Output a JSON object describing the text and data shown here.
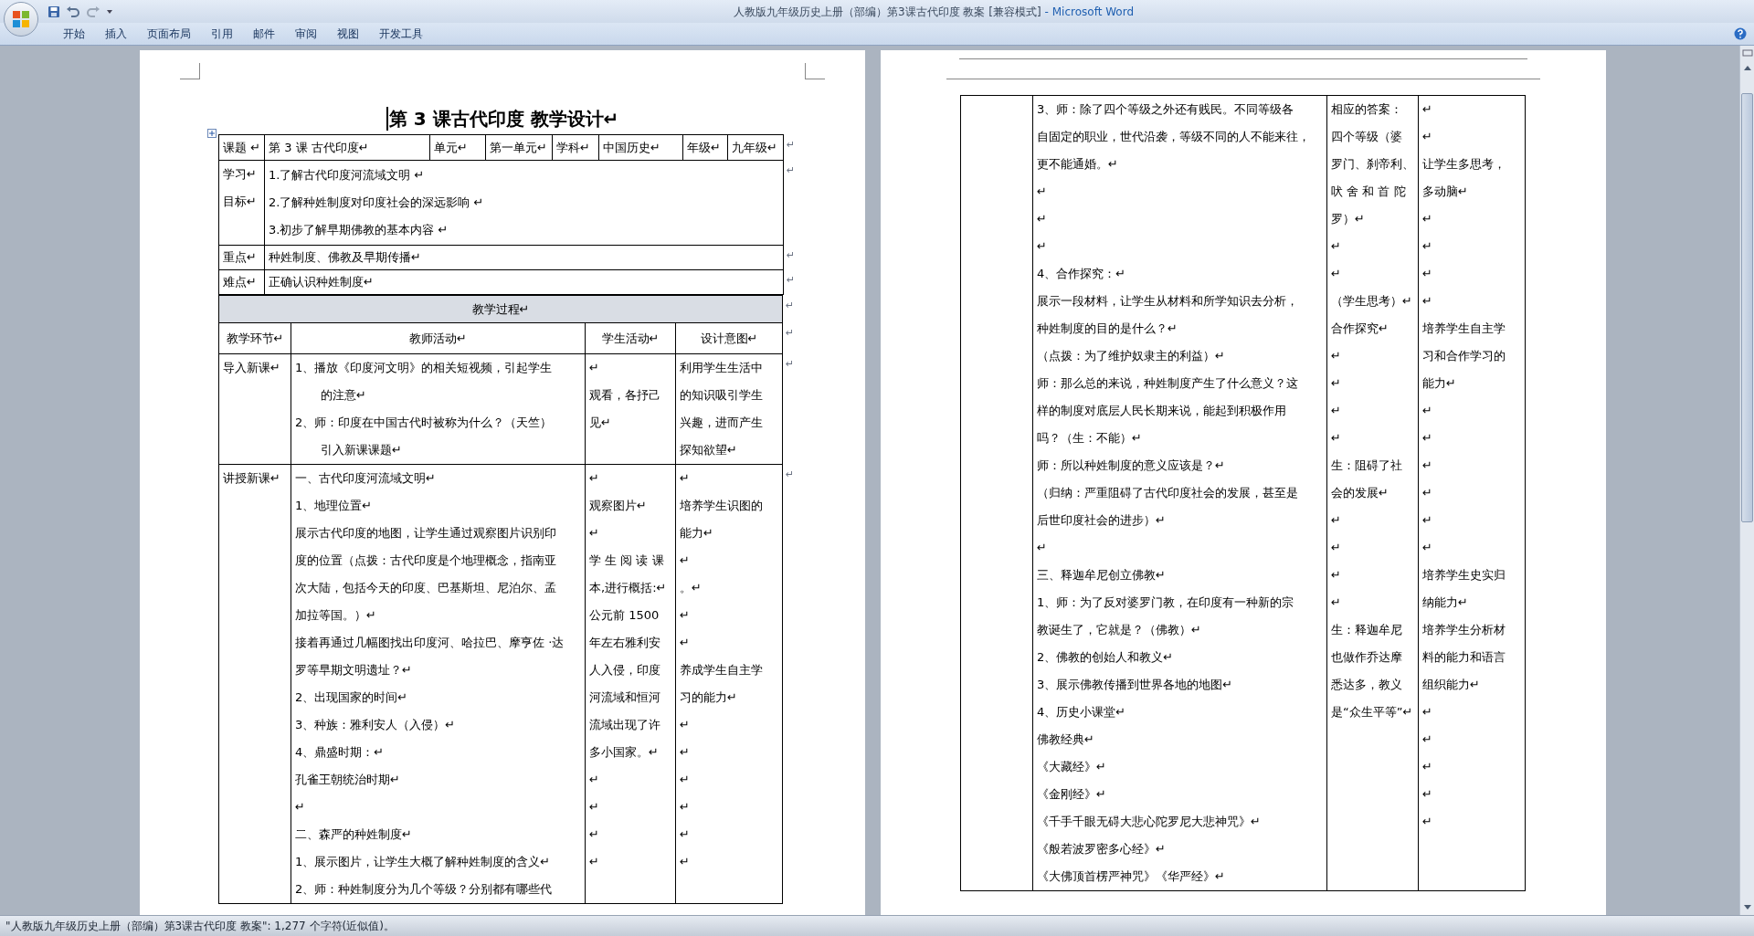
{
  "window": {
    "title": "人教版九年级历史上册（部编）第3课古代印度 教案 [兼容模式]",
    "app_suffix": "- Microsoft Word"
  },
  "ribbon_tabs": [
    "开始",
    "插入",
    "页面布局",
    "引用",
    "邮件",
    "审阅",
    "视图",
    "开发工具"
  ],
  "left_page": {
    "heading": "第 3 课古代印度  教学设计↵",
    "info_table": {
      "header_cells": [
        "课题 ↵",
        "第 3 课 古代印度↵",
        "单元↵",
        "第一单元↵",
        "学科↵",
        "中国历史↵",
        "年级↵",
        "九年级↵"
      ],
      "header_end": "↵",
      "objectives": {
        "label": [
          "学习↵",
          "目标↵"
        ],
        "items": [
          "1.了解古代印度河流域文明 ↵",
          "2.了解种姓制度对印度社会的深远影响 ↵",
          "3.初步了解早期佛教的基本内容 ↵"
        ],
        "end": "↵"
      },
      "rows": [
        {
          "label": "重点↵",
          "value": "种姓制度、佛教及早期传播↵",
          "end": "↵"
        },
        {
          "label": "难点↵",
          "value": "正确认识种姓制度↵",
          "end": "↵"
        }
      ]
    },
    "process_table": {
      "caption": "教学过程↵",
      "caption_end": "↵",
      "columns": [
        "教学环节↵",
        "教师活动↵",
        "学生活动↵",
        "设计意图↵"
      ],
      "columns_end": "↵",
      "rows": [
        {
          "stage": [
            "导入新课↵"
          ],
          "teacher": [
            {
              "kind": "item",
              "text": "1、播放《印度河文明》的相关短视频，引起学生"
            },
            {
              "kind": "cont",
              "text": "的注意↵"
            },
            {
              "kind": "item",
              "text": "2、师：印度在中国古代时被称为什么？（天竺）"
            },
            {
              "kind": "cont",
              "text": "引入新课课题↵"
            }
          ],
          "student": [
            "↵",
            "观看，各抒己",
            "见↵"
          ],
          "design": [
            "利用学生生活中",
            "的知识吸引学生",
            "兴趣，进而产生",
            "探知欲望↵"
          ],
          "end": "↵"
        },
        {
          "stage": [
            "讲授新课↵"
          ],
          "teacher": [
            "一、古代印度河流域文明↵",
            "1、地理位置↵",
            "展示古代印度的地图，让学生通过观察图片识别印",
            "度的位置（点拨：古代印度是个地理概念，指南亚",
            "次大陆，包括今天的印度、巴基斯坦、尼泊尔、孟",
            "加拉等国。）↵",
            "接着再通过几幅图找出印度河、哈拉巴、摩亨佐 ·达",
            "罗等早期文明遗址？↵",
            "2、出现国家的时间↵",
            "3、种族：雅利安人（入侵）↵",
            "4、鼎盛时期：↵",
            "孔雀王朝统治时期↵",
            "↵",
            "二、森严的种姓制度↵",
            "1、展示图片，让学生大概了解种姓制度的含义↵",
            "2、师：种姓制度分为几个等级？分别都有哪些代"
          ],
          "student": [
            "↵",
            "观察图片↵",
            "↵",
            "学 生 阅 读 课",
            "本,进行概括:↵",
            "公元前  1500",
            "年左右雅利安",
            "人入侵，印度",
            "河流域和恒河",
            "流域出现了许",
            "多小国家。↵",
            "↵",
            "↵",
            "↵",
            "↵"
          ],
          "design": [
            "↵",
            "培养学生识图的",
            "能力↵",
            "↵",
            "。↵",
            "↵",
            "↵",
            "养成学生自主学",
            "习的能力↵",
            "↵",
            "↵",
            "↵",
            "↵",
            "↵",
            "↵"
          ],
          "end": "↵"
        }
      ]
    }
  },
  "right_page": {
    "process_table": {
      "rows": [
        {
          "stage": [],
          "teacher": [
            "3、师：除了四个等级之外还有贱民。不同等级各",
            "自固定的职业，世代沿袭，等级不同的人不能来往，",
            "更不能通婚。↵",
            "↵",
            "↵",
            "↵",
            "4、合作探究：↵",
            "展示一段材料，让学生从材料和所学知识去分析，",
            "种姓制度的目的是什么？↵",
            "（点拨：为了维护奴隶主的利益）↵",
            "师：那么总的来说，种姓制度产生了什么意义？这",
            "样的制度对底层人民长期来说，能起到积极作用",
            "吗？（生：不能）↵",
            "师：所以种姓制度的意义应该是？↵",
            "（归纳：严重阻碍了古代印度社会的发展，甚至是",
            "后世印度社会的进步）↵",
            "↵",
            "三、释迦牟尼创立佛教↵",
            "1、师：为了反对婆罗门教，在印度有一种新的宗",
            "教诞生了，它就是？（佛教）↵",
            "2、佛教的创始人和教义↵",
            "3、展示佛教传播到世界各地的地图↵",
            "4、历史小课堂↵",
            "佛教经典↵",
            "《大藏经》↵",
            "《金刚经》↵",
            "《千手千眼无碍大悲心陀罗尼大悲神咒》↵",
            "《般若波罗密多心经》↵",
            "《大佛顶首楞严神咒》《华严经》↵"
          ],
          "student": [
            "相应的答案：",
            "四个等级（婆",
            "罗门、刹帝利、",
            "吠 舍 和 首 陀",
            "罗）↵",
            "↵",
            "↵",
            "（学生思考）↵",
            "合作探究↵",
            "↵",
            "↵",
            "↵",
            "↵",
            "生：阻碍了社",
            "会的发展↵",
            "↵",
            "↵",
            "↵",
            "↵",
            "生：释迦牟尼",
            "也做作乔达摩",
            "悉达多，教义",
            "是“众生平等”↵"
          ],
          "design": [
            "↵",
            "↵",
            "让学生多思考，",
            "多动脑↵",
            "↵",
            "↵",
            "↵",
            "↵",
            "培养学生自主学",
            "习和合作学习的",
            "能力↵",
            "↵",
            "↵",
            "↵",
            "↵",
            "↵",
            "↵",
            "培养学生史实归",
            "纳能力↵",
            "培养学生分析材",
            "料的能力和语言",
            "组织能力↵",
            "↵",
            "↵",
            "↵",
            "↵",
            "↵"
          ]
        }
      ]
    }
  },
  "status_bar": {
    "text": "\"人教版九年级历史上册（部编）第3课古代印度 教案\": 1,277 个字符(近似值)。"
  }
}
